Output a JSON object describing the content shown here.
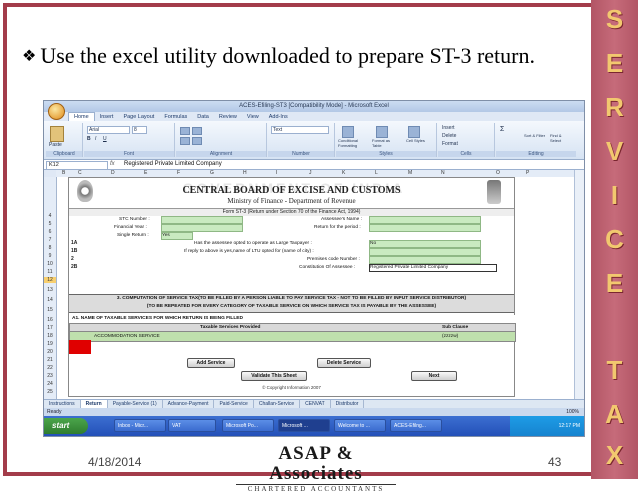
{
  "slide": {
    "bullet_text": "Use the excel utility downloaded to prepare ST-3 return.",
    "date": "4/18/2014",
    "page_number": "43",
    "logo_main": "ASAP & Associates",
    "logo_sub": "CHARTERED ACCOUNTANTS",
    "side_letters": [
      "S",
      "E",
      "R",
      "V",
      "I",
      "C",
      "E",
      "",
      "T",
      "A",
      "X"
    ]
  },
  "excel": {
    "title": "ACES-Efiling-ST3 [Compatibility Mode] - Microsoft Excel",
    "tabs": [
      "Home",
      "Insert",
      "Page Layout",
      "Formulas",
      "Data",
      "Review",
      "View",
      "Add-Ins"
    ],
    "active_tab": "Home",
    "ribbon_groups": [
      "Clipboard",
      "Font",
      "Alignment",
      "Number",
      "Styles",
      "Cells",
      "Editing"
    ],
    "ribbon_controls": {
      "paste": "Paste",
      "font_name": "Arial",
      "font_size": "8",
      "number_format": "Text",
      "conditional_formatting": "Conditional Formatting",
      "format_as_table": "Format as Table",
      "cell_styles": "Cell Styles",
      "insert": "Insert",
      "delete": "Delete",
      "format": "Format",
      "sort_filter": "Sort & Filter",
      "find_select": "Find & Select"
    },
    "name_box": "K12",
    "fx": "fx",
    "formula": "Registered Private Limited Company",
    "columns": [
      "B",
      "C",
      "D",
      "E",
      "F",
      "G",
      "H",
      "I",
      "J",
      "K",
      "L",
      "M",
      "N",
      "O",
      "P"
    ],
    "rows": [
      "4",
      "5",
      "6",
      "7",
      "8",
      "9",
      "10",
      "11",
      "12",
      "13",
      "14",
      "15",
      "16",
      "17",
      "18",
      "19",
      "20",
      "21",
      "22",
      "23",
      "24",
      "25",
      "26",
      "27"
    ],
    "sheet_tabs": [
      "Instructions",
      "Return",
      "Payable-Service (1)",
      "Advance-Payment",
      "Paid-Service",
      "Challan-Service",
      "CENVAT",
      "Distributor"
    ],
    "active_sheet": "Return",
    "status": "Ready",
    "zoom": "100%"
  },
  "form": {
    "watermark": "GOVERNMENT OF INDIA",
    "title": "CENTRAL BOARD OF EXCISE AND CUSTOMS",
    "ministry": "Ministry of Finance - Department of Revenue",
    "form_heading": "Form ST-3 (Return under Section 70 of the Finance Act, 1994)",
    "stc_number_label": "STC Number :",
    "assessee_name_label": "Assessee's Name :",
    "financial_year_label": "Financial Year :",
    "return_period_label": "Return for the period :",
    "single_return_label": "Single Return :",
    "single_return_value": "Yes",
    "row_1a": "1A",
    "q_large_taxpayer": "Has the assessee opted to operate as Large Taxpayer :",
    "q_large_taxpayer_value": "No",
    "row_1b": "1B",
    "q_ltu": "If reply to above is yes,name of LTU opted for (name of city) :",
    "row_2": "2",
    "premises_code_label": "Premises code Number :",
    "row_2b": "2B",
    "constitution_label": "Constitution Of Assessee :",
    "constitution_value": "Registered Private Limited Company",
    "section3_line1": "3. COMPUTATION OF SERVICE TAX(TO BE FILLED BY A PERSON LIABLE TO PAY SERVICE TAX - NOT TO BE FILLED BY INPUT SERVICE DISTRIBUTOR)",
    "section3_line2": "(TO BE REPEATED FOR EVERY CATEGORY OF TAXABLE SERVICE ON WHICH SERVICE TAX IS PAYABLE BY THE ASSESSEE)",
    "section_a": "A1. NAME OF TAXABLE SERVICES FOR WHICH RETURN IS BEING FILLED",
    "taxable_services_header": "Taxable Services Provided",
    "sub_clause_header": "Sub Clause",
    "service_value": "ACCOMMODATION SERVICE",
    "sub_clause_value": "(zzzzw)",
    "add_service": "Add Service",
    "delete_service": "Delete Service",
    "validate_sheet": "Validate This Sheet",
    "next": "Next",
    "copyright": "© Copyright Information 2007"
  },
  "taskbar": {
    "start": "start",
    "tasks": [
      "Inbox - Micr...",
      "VAT",
      "Microsoft Po...",
      "Microsoft ...",
      "Welcome to ...",
      "ACES-Efilng..."
    ],
    "clock": "12:17 PM"
  },
  "colors": {
    "frame": "#a33c4a",
    "band": "#b25565",
    "band_letters": "#f2c86f",
    "input_green": "#c9eac0",
    "error_red": "#e00000"
  }
}
